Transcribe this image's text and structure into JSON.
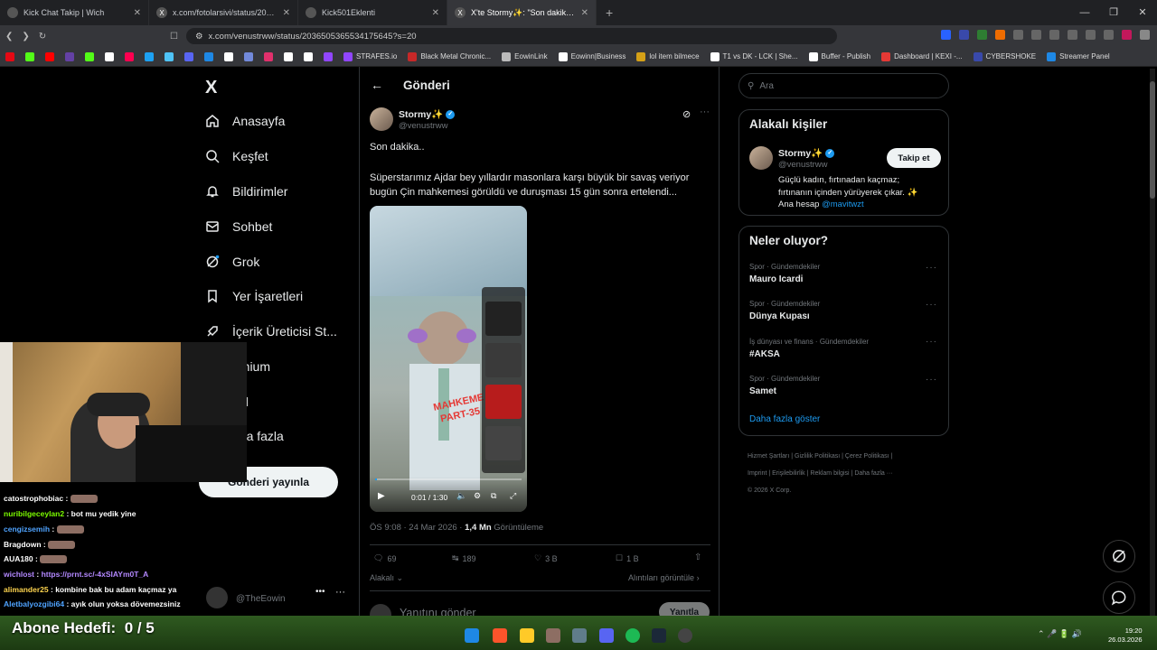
{
  "browser": {
    "tabs": [
      {
        "title": "Kick Chat Takip | Wich",
        "active": false
      },
      {
        "title": "x.com/fotolarsivi/status/20367016950",
        "active": false
      },
      {
        "title": "Kick501Eklenti",
        "active": false
      },
      {
        "title": "X'te Stormy✨: \"Son dakika..\"",
        "active": true
      }
    ],
    "url": "x.com/venustrww/status/2036505365534175645?s=20",
    "bookmarks": [
      {
        "label": "",
        "color": "#e50914"
      },
      {
        "label": "",
        "color": "#53fc18"
      },
      {
        "label": "",
        "color": "#ff0000"
      },
      {
        "label": "",
        "color": "#6441a5"
      },
      {
        "label": "",
        "color": "#53fc18"
      },
      {
        "label": "",
        "color": "#ffffff"
      },
      {
        "label": "",
        "color": "#ff0050"
      },
      {
        "label": "",
        "color": "#1da1f2"
      },
      {
        "label": "",
        "color": "#4fc3f7"
      },
      {
        "label": "",
        "color": "#5865f2"
      },
      {
        "label": "",
        "color": "#1e88e5"
      },
      {
        "label": "",
        "color": "#ffffff"
      },
      {
        "label": "",
        "color": "#7289da"
      },
      {
        "label": "",
        "color": "#e1306c"
      },
      {
        "label": "",
        "color": "#ffffff"
      },
      {
        "label": "",
        "color": "#ffffff"
      },
      {
        "label": "",
        "color": "#9146ff"
      },
      {
        "label": "STRAFES.io",
        "color": "#9146ff"
      },
      {
        "label": "Black Metal Chronic...",
        "color": "#c62828"
      },
      {
        "label": "EowinLink",
        "color": "#bbbbbb"
      },
      {
        "label": "Eowinn|Business",
        "color": "#ffffff"
      },
      {
        "label": "lol item bilmece",
        "color": "#d4a017"
      },
      {
        "label": "T1 vs DK - LCK | She...",
        "color": "#ffffff"
      },
      {
        "label": "Buffer - Publish",
        "color": "#ffffff"
      },
      {
        "label": "Dashboard | KEXI -...",
        "color": "#e53935"
      },
      {
        "label": "CYBERSHOKE",
        "color": "#3949ab"
      },
      {
        "label": "Streamer Panel",
        "color": "#1e88e5"
      }
    ]
  },
  "nav": {
    "logo": "X",
    "items": [
      {
        "label": "Anasayfa",
        "icon": "home-icon"
      },
      {
        "label": "Keşfet",
        "icon": "search-icon"
      },
      {
        "label": "Bildirimler",
        "icon": "bell-icon"
      },
      {
        "label": "Sohbet",
        "icon": "mail-icon"
      },
      {
        "label": "Grok",
        "icon": "grok-icon"
      },
      {
        "label": "Yer İşaretleri",
        "icon": "bookmark-icon"
      },
      {
        "label": "İçerik Üreticisi St...",
        "icon": "rocket-icon"
      },
      {
        "label": "emium",
        "icon": "premium-icon"
      },
      {
        "label": "ofil",
        "icon": "profile-icon"
      },
      {
        "label": "aha fazla",
        "icon": "more-icon"
      }
    ],
    "post_button": "Gönderi yayınla",
    "account_handle": "@TheEowin"
  },
  "post": {
    "header_title": "Gönderi",
    "author_name": "Stormy✨",
    "author_handle": "@venustrww",
    "line1": "Son dakika..",
    "line2": "Süperstarımız Ajdar bey yıllardır masonlara karşı büyük bir savaş veriyor",
    "line3": "bugün Çin mahkemesi görüldü ve duruşması 15 gün sonra ertelendi...",
    "video": {
      "time": "0:01 / 1:30",
      "overlay_text_1": "MAHKEME",
      "overlay_text_2": "PART-35",
      "progress": 0.011
    },
    "timestamp": "ÖS 9:08 · 24 Mar 2026 · ",
    "views_count": "1,4 Mn",
    "views_label": "Görüntüleme",
    "replies": "69",
    "reposts": "189",
    "likes": "3 B",
    "bookmarks": "1 B",
    "related_label": "Alakalı",
    "quotes_label": "Alıntıları görüntüle",
    "reply_placeholder": "Yanıtını gönder",
    "reply_button": "Yanıtla"
  },
  "sidebar": {
    "search_placeholder": "Ara",
    "relevant_title": "Alakalı kişiler",
    "person": {
      "name": "Stormy✨",
      "handle": "@venustrww",
      "bio_1": "Güçlü kadın, fırtınadan kaçmaz;",
      "bio_2": "fırtınanın içinden yürüyerek çıkar. ✨",
      "bio_3_prefix": "Ana hesap ",
      "bio_3_link": "@mavitwzt",
      "follow_label": "Takip et"
    },
    "trends_title": "Neler oluyor?",
    "trends": [
      {
        "category": "Spor · Gündemdekiler",
        "name": "Mauro Icardi"
      },
      {
        "category": "Spor · Gündemdekiler",
        "name": "Dünya Kupası"
      },
      {
        "category": "İş dünyası ve finans · Gündemdekiler",
        "name": "#AKSA"
      },
      {
        "category": "Spor · Gündemdekiler",
        "name": "Samet"
      }
    ],
    "show_more": "Daha fazla göster",
    "footer": [
      "Hizmet Şartları",
      "Gizlilik Politikası",
      "Çerez Politikası",
      "Imprint",
      "Erişilebilirlik",
      "Reklam bilgisi",
      "Daha fazla ···",
      "© 2026 X Corp."
    ]
  },
  "chat": [
    {
      "user": "catostrophobiac",
      "msg": "",
      "color": "#ffffff"
    },
    {
      "user": "nuribilgeceylan2",
      "msg": "bot mu yedik yine",
      "color": "#7cfc00"
    },
    {
      "user": "cengizsemih",
      "msg": "",
      "color": "#4fa3ff"
    },
    {
      "user": "Bragdown",
      "msg": "",
      "color": "#ffffff"
    },
    {
      "user": "AUA180",
      "msg": "",
      "color": "#ffffff"
    },
    {
      "user": "wichlost",
      "msg": "https://prnt.sc/-4xSIAYm0T_A",
      "color": "#b388ff"
    },
    {
      "user": "alimander25",
      "msg": "kombine bak bu adam kaçmaz ya",
      "color": "#ffd54f"
    },
    {
      "user": "Aletbalyozgibi64",
      "msg": "ayık olun yoksa dövemezsiniz",
      "color": "#4fa3ff"
    }
  ],
  "abone": {
    "label": "Abone Hedefi:",
    "value": "0 / 5"
  },
  "taskbar": {
    "time": "19:20",
    "date": "26.03.2026"
  }
}
